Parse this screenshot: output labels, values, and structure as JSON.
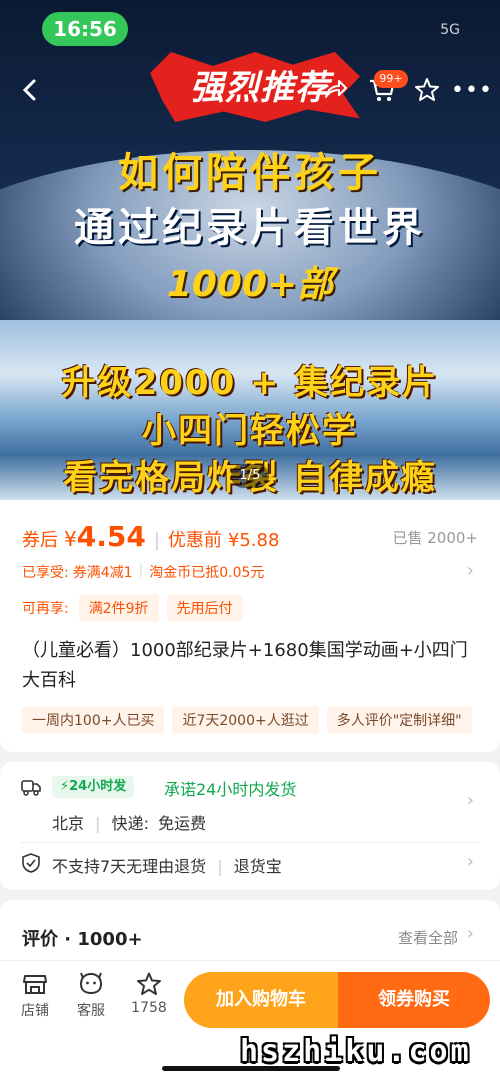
{
  "status_bar": {
    "time": "16:56",
    "network": "5G"
  },
  "nav": {
    "cart_badge": "99+"
  },
  "hero": {
    "stamp": "强烈推荐",
    "line1": "如何陪伴孩子",
    "line2": "通过纪录片看世界",
    "line3": "1000+部",
    "line4": "升级2000 + 集纪录片",
    "line5": "小四门轻松学",
    "line6": "看完格局炸裂 自律成瘾",
    "counter": "1/5"
  },
  "price": {
    "after_label": "券后",
    "currency": "¥",
    "after_value": "4.54",
    "before_label": "优惠前",
    "before_value": "¥5.88",
    "sold": "已售 2000+"
  },
  "enjoyed": {
    "label": "已享受:",
    "coupon": "券满4减1",
    "coins": "淘金币已抵0.05元"
  },
  "can_enjoy": {
    "label": "可再享:",
    "chips": [
      "满2件9折",
      "先用后付"
    ]
  },
  "product": {
    "title": "（儿童必看）1000部纪录片+1680集国学动画+小四门大百科"
  },
  "tags": [
    "一周内100+人已买",
    "近7天2000+人逛过",
    "多人评价\"定制详细\""
  ],
  "shipping": {
    "badge": "24小时发",
    "promise": "承诺24小时内发货",
    "location": "北京",
    "express_label": "快递:",
    "express_value": "免运费"
  },
  "returns": {
    "policy": "不支持7天无理由退货",
    "insurance": "退货宝"
  },
  "reviews": {
    "title": "评价 · 1000+",
    "view_all": "查看全部"
  },
  "bottom_bar": {
    "shop": "店铺",
    "service": "客服",
    "fav_count": "1758",
    "add_cart": "加入购物车",
    "buy": "领券购买"
  },
  "watermark": "hszhiku.com",
  "colors": {
    "accent": "#ff5000",
    "green": "#11a84e",
    "cart_btn": "#ffa31a",
    "buy_btn": "#ff6a13"
  }
}
